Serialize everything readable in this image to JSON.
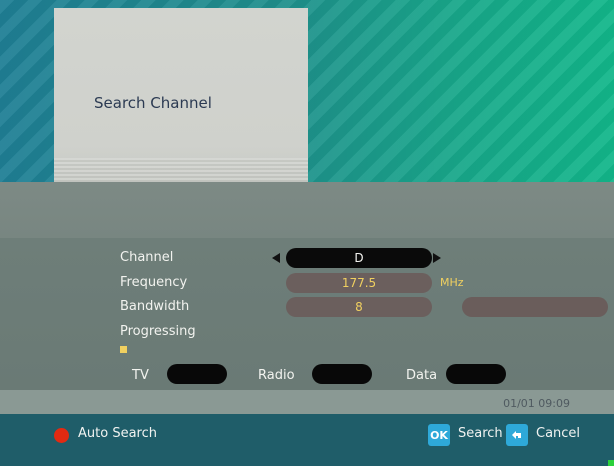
{
  "title": "Search Channel",
  "fields": {
    "channel": {
      "label": "Channel",
      "value": "D"
    },
    "frequency": {
      "label": "Frequency",
      "value": "177.5",
      "unit": "MHz"
    },
    "bandwidth": {
      "label": "Bandwidth",
      "value": "8"
    },
    "progressing": {
      "label": "Progressing"
    }
  },
  "types": {
    "tv": "TV",
    "radio": "Radio",
    "data": "Data"
  },
  "datetime": "01/01 09:09",
  "buttons": {
    "auto_search": "Auto Search",
    "ok_key": "OK",
    "search": "Search",
    "cancel": "Cancel"
  },
  "colors": {
    "accent_red": "#e22a12",
    "accent_blue": "#2ea9d9",
    "value_yellow": "#f0d060",
    "bottom_bar": "#1f5d69"
  },
  "icons": {
    "channel_prev": "triangle-left-icon",
    "channel_next": "triangle-right-icon",
    "red_button": "red-circle-icon",
    "ok_key": "ok-key-icon",
    "back_key": "return-arrow-icon"
  }
}
